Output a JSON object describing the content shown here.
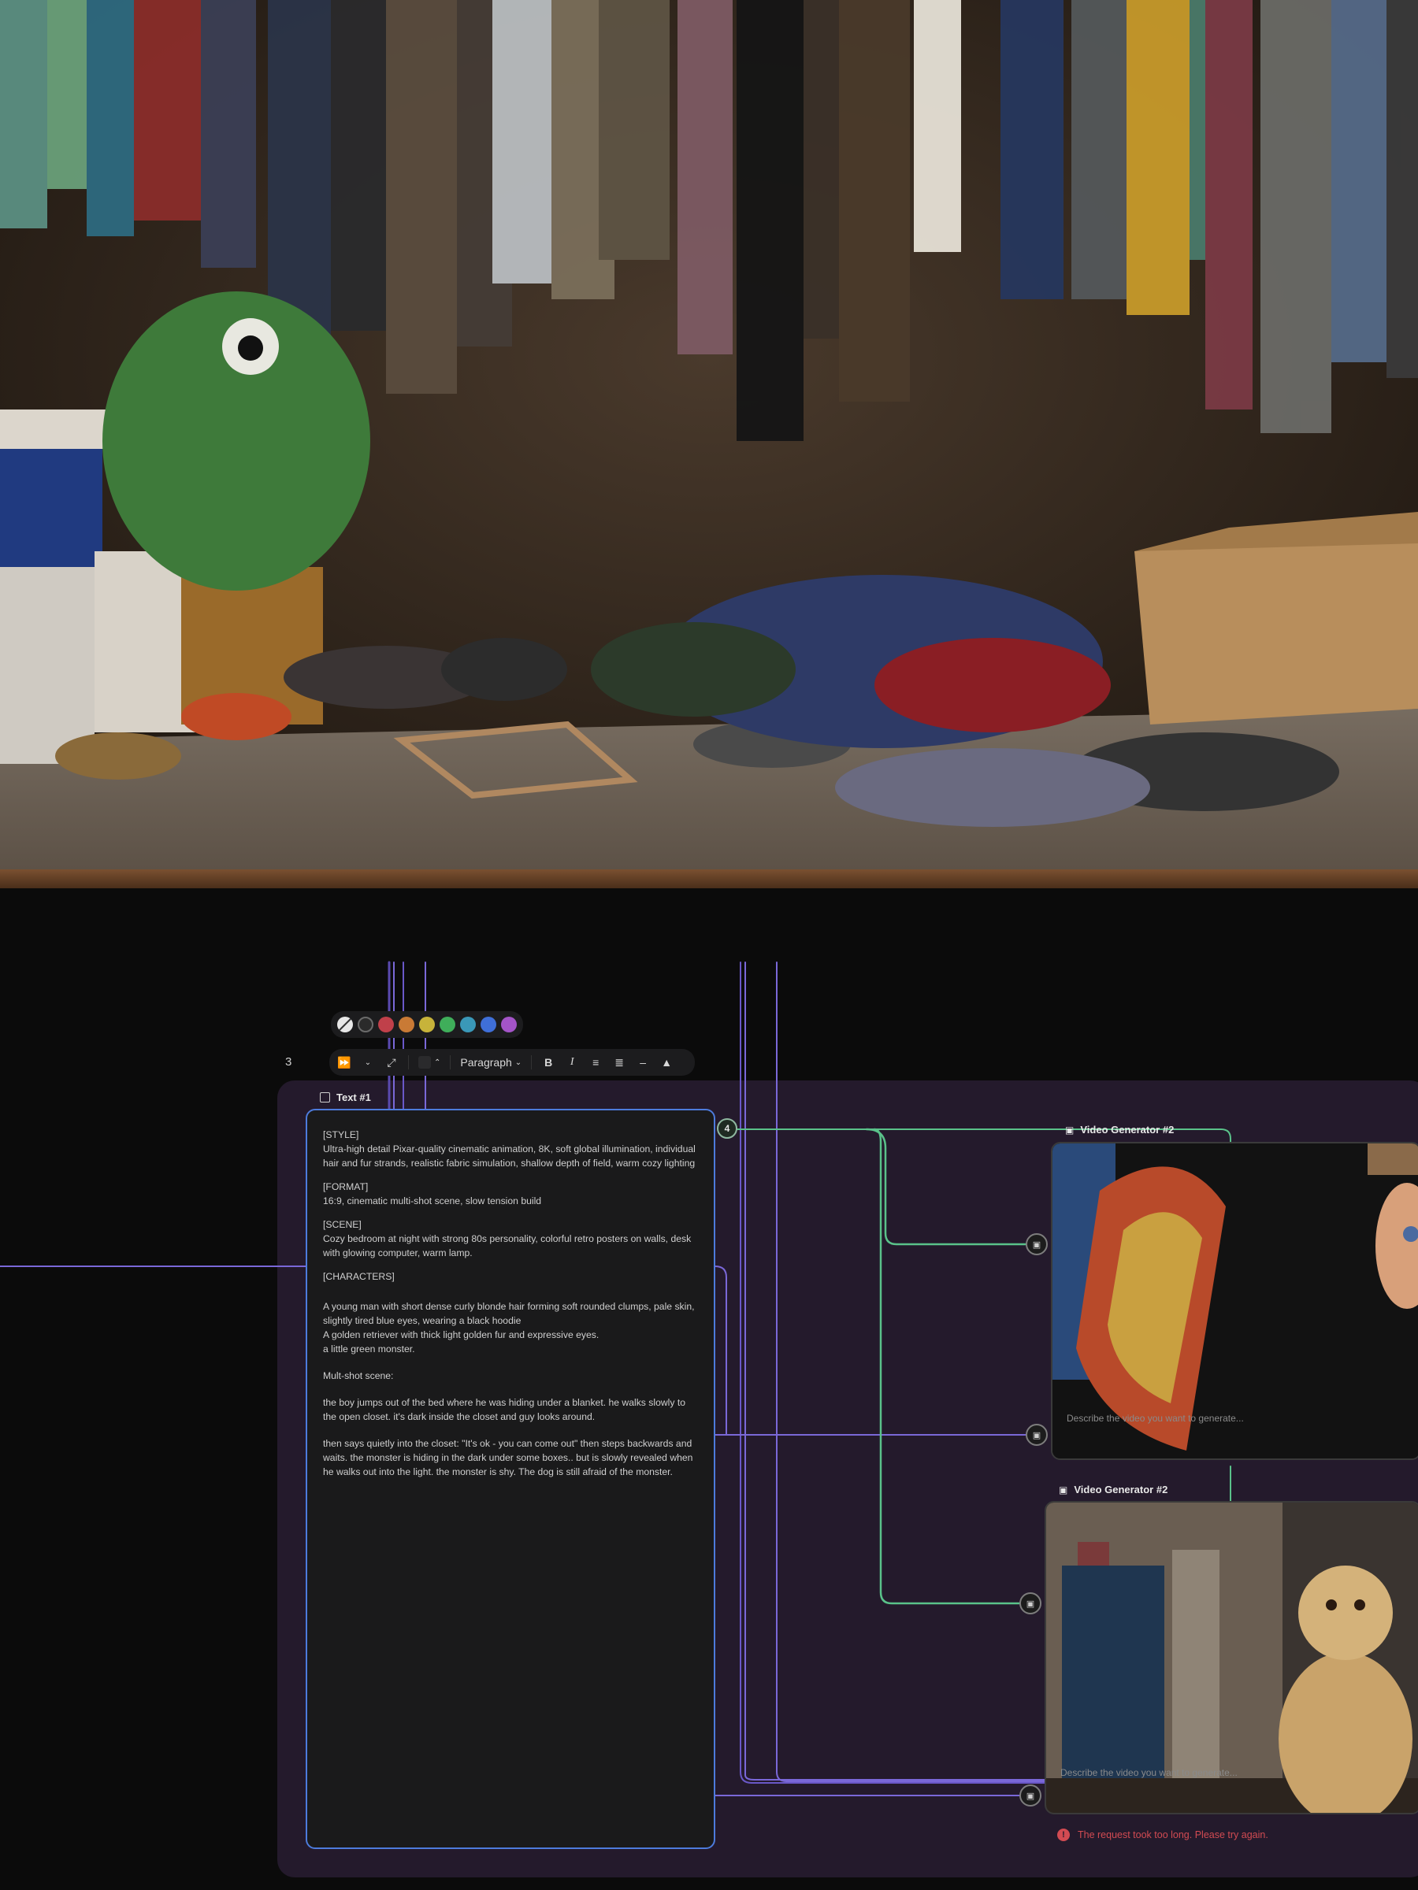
{
  "toolbar": {
    "layer_number": "3",
    "swatches": [
      {
        "name": "none",
        "color": "#e8e8e8"
      },
      {
        "name": "black",
        "color": "#2a2a2a"
      },
      {
        "name": "red",
        "color": "#c0404a"
      },
      {
        "name": "orange",
        "color": "#c97a35"
      },
      {
        "name": "yellow",
        "color": "#c7b33a"
      },
      {
        "name": "green",
        "color": "#3fae5a"
      },
      {
        "name": "teal",
        "color": "#3a98b8"
      },
      {
        "name": "blue",
        "color": "#3f6fd8"
      },
      {
        "name": "purple",
        "color": "#a454c8"
      }
    ],
    "paragraph_label": "Paragraph"
  },
  "text_node": {
    "title": "Text #1",
    "paragraphs": [
      "[STYLE]\nUltra-high detail Pixar-quality cinematic animation, 8K, soft global illumination, individual hair and fur strands, realistic fabric simulation, shallow depth of field, warm cozy lighting",
      "[FORMAT]\n16:9, cinematic multi-shot scene, slow tension build",
      "[SCENE]\nCozy bedroom at night with strong 80s personality, colorful retro posters on walls, desk with glowing computer, warm lamp.",
      "[CHARACTERS]",
      "A young man with short dense curly blonde hair forming soft rounded clumps, pale skin, slightly tired blue eyes, wearing a black hoodie\nA golden retriever with thick light golden fur and expressive eyes.\na little green monster.",
      "Mult-shot scene:",
      "the boy jumps out of the bed where he was hiding under a blanket. he walks slowly to the open closet. it's dark inside the closet and guy looks around.",
      "then says quietly into the closet: \"It's ok - you can come out\" then steps backwards and waits. the monster is hiding in the dark under some boxes.. but is slowly revealed when he walks out into the light. the monster is shy. The dog is still afraid of the monster."
    ],
    "badge": "4"
  },
  "video_generators": [
    {
      "title": "Video Generator #2",
      "placeholder": "Describe the video you want to generate..."
    },
    {
      "title": "Video Generator #2",
      "placeholder": "Describe the video you want to generate..."
    }
  ],
  "error_message": "The request took too long. Please try again.",
  "colors": {
    "group_bg": "#241a2c",
    "text_card_border": "#4d7bdc",
    "edge_green": "#5ac28a",
    "edge_purple": "#7a68d8",
    "error": "#d24b52"
  }
}
